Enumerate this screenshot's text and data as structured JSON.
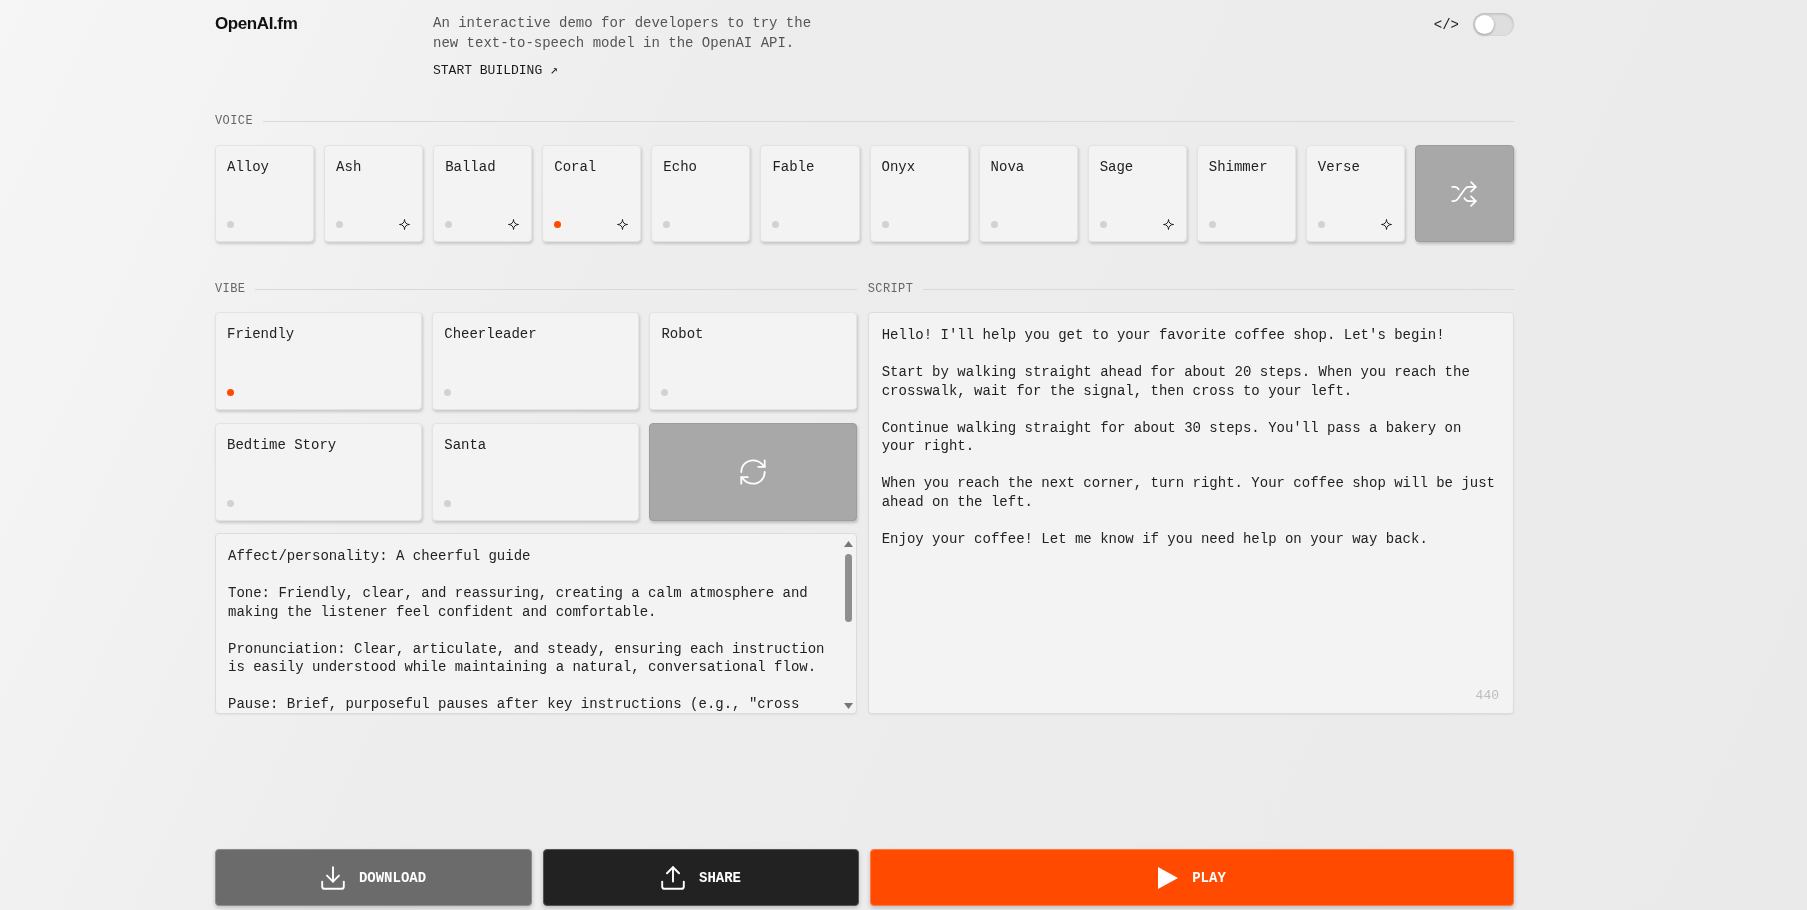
{
  "header": {
    "logo": "OpenAI.fm",
    "description": "An interactive demo for developers to try the new text-to-speech model in the OpenAI API.",
    "link": "START BUILDING ↗",
    "code_toggle": {
      "label": "</>",
      "on": false
    }
  },
  "voice": {
    "label": "VOICE",
    "items": [
      {
        "name": "Alloy",
        "selected": false,
        "sparkle": false
      },
      {
        "name": "Ash",
        "selected": false,
        "sparkle": true
      },
      {
        "name": "Ballad",
        "selected": false,
        "sparkle": true
      },
      {
        "name": "Coral",
        "selected": true,
        "sparkle": true
      },
      {
        "name": "Echo",
        "selected": false,
        "sparkle": false
      },
      {
        "name": "Fable",
        "selected": false,
        "sparkle": false
      },
      {
        "name": "Onyx",
        "selected": false,
        "sparkle": false
      },
      {
        "name": "Nova",
        "selected": false,
        "sparkle": false
      },
      {
        "name": "Sage",
        "selected": false,
        "sparkle": true
      },
      {
        "name": "Shimmer",
        "selected": false,
        "sparkle": false
      },
      {
        "name": "Verse",
        "selected": false,
        "sparkle": true
      }
    ]
  },
  "vibe": {
    "label": "VIBE",
    "items": [
      {
        "name": "Friendly",
        "selected": true
      },
      {
        "name": "Cheerleader",
        "selected": false
      },
      {
        "name": "Robot",
        "selected": false
      },
      {
        "name": "Bedtime Story",
        "selected": false
      },
      {
        "name": "Santa",
        "selected": false
      }
    ],
    "instructions": "Affect/personality: A cheerful guide\n\nTone: Friendly, clear, and reassuring, creating a calm atmosphere and making the listener feel confident and comfortable.\n\nPronunciation: Clear, articulate, and steady, ensuring each instruction is easily understood while maintaining a natural, conversational flow.\n\nPause: Brief, purposeful pauses after key instructions (e.g., \"cross"
  },
  "script": {
    "label": "SCRIPT",
    "text": "Hello! I'll help you get to your favorite coffee shop. Let's begin!\n\nStart by walking straight ahead for about 20 steps. When you reach the crosswalk, wait for the signal, then cross to your left.\n\nContinue walking straight for about 30 steps. You'll pass a bakery on your right.\n\nWhen you reach the next corner, turn right. Your coffee shop will be just ahead on the left.\n\nEnjoy your coffee! Let me know if you need help on your way back.",
    "char_count": "440"
  },
  "actions": [
    {
      "kind": "download",
      "label": "DOWNLOAD"
    },
    {
      "kind": "share",
      "label": "SHARE"
    },
    {
      "kind": "play",
      "label": "PLAY"
    }
  ]
}
